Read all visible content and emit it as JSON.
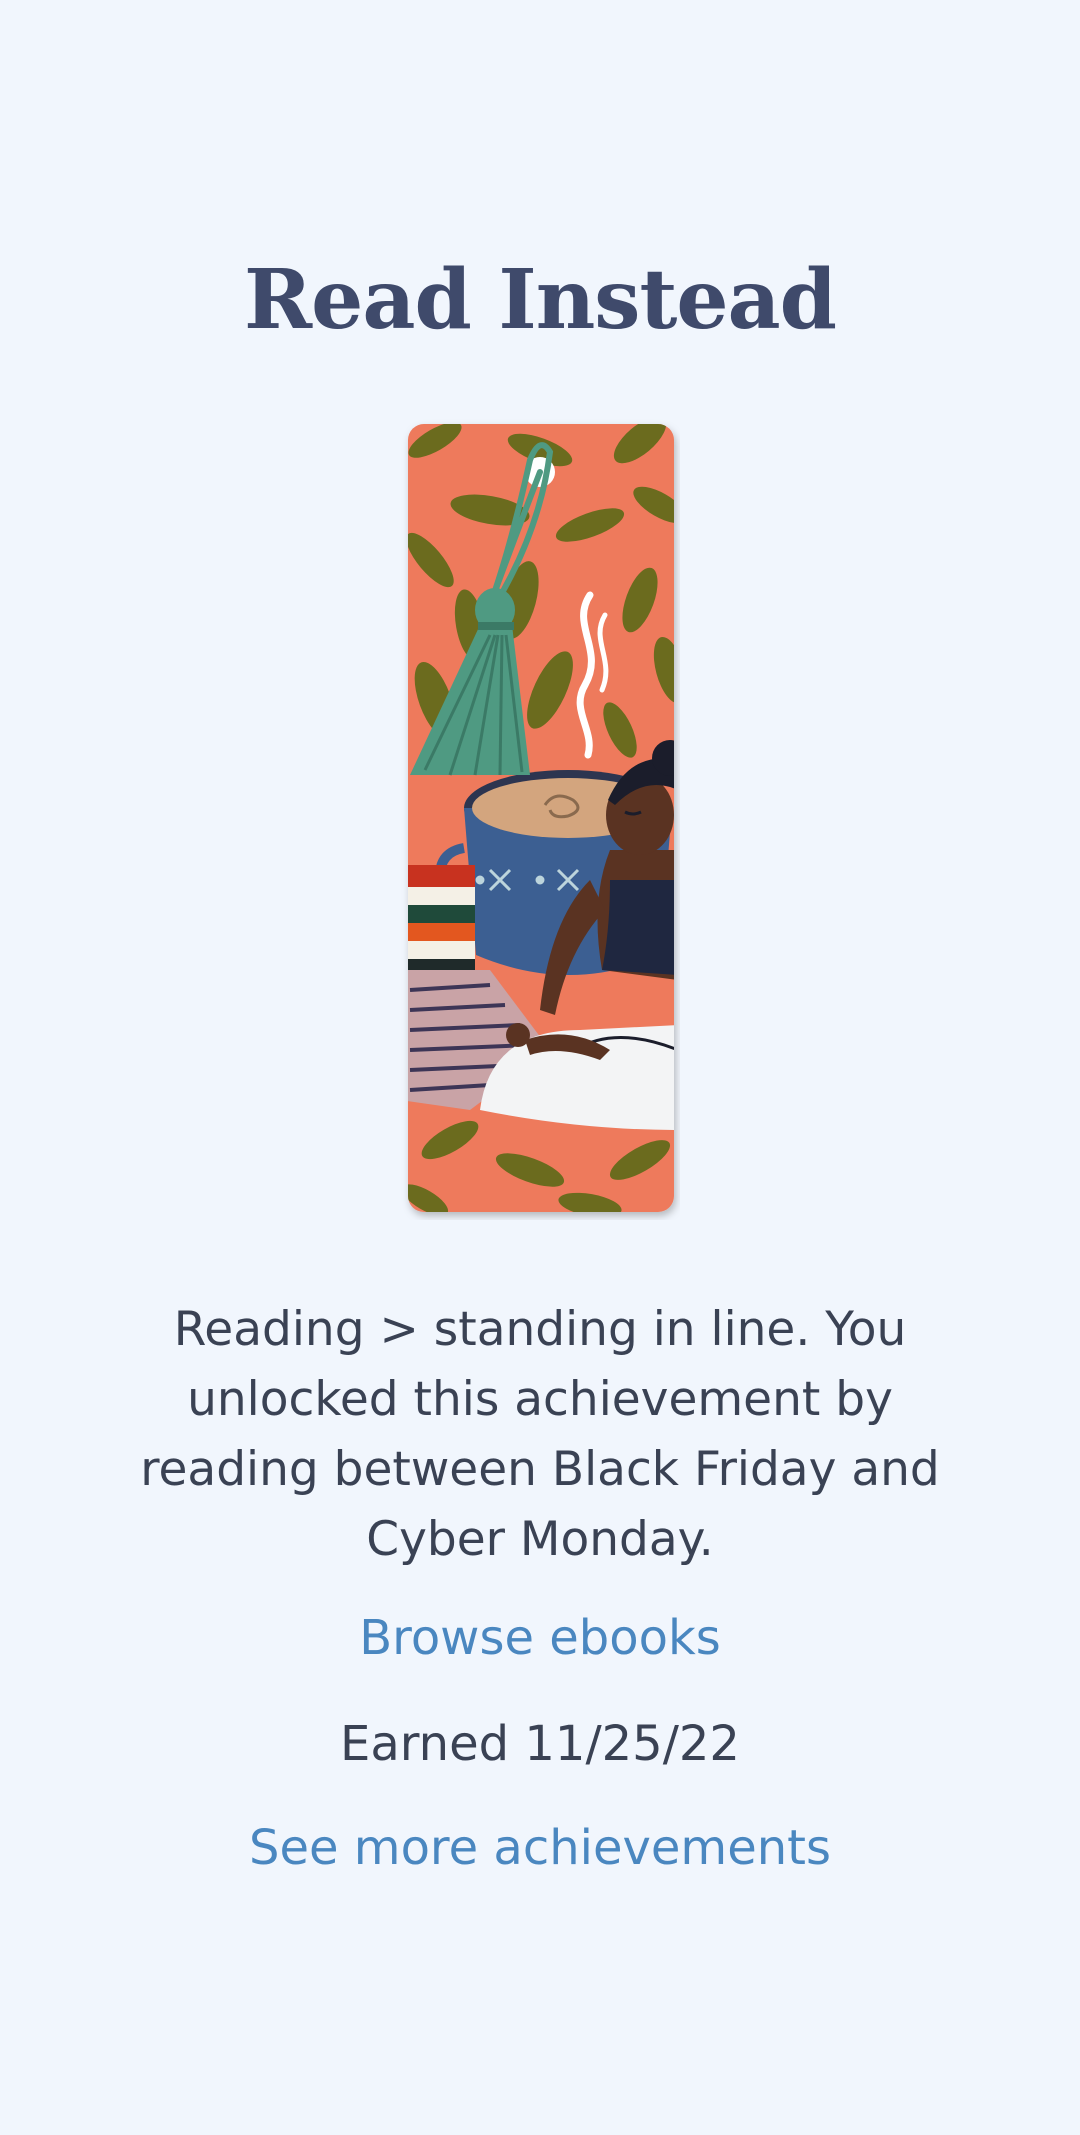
{
  "achievement": {
    "title": "Read Instead",
    "description": "Reading > standing in line. You unlocked this achievement by reading between Black Friday and Cyber Monday.",
    "browse_link": "Browse ebooks",
    "earned_label": "Earned 11/25/22",
    "more_link": "See more achievements"
  },
  "colors": {
    "background": "#f1f6fd",
    "title": "#3f4a6b",
    "text": "#3a4254",
    "link": "#4a87c0",
    "bookmark_bg": "#ee7a5b",
    "leaf": "#6b6b1e",
    "tassel": "#4f9a82"
  },
  "icons": {
    "bookmark": "bookmark-illustration"
  }
}
